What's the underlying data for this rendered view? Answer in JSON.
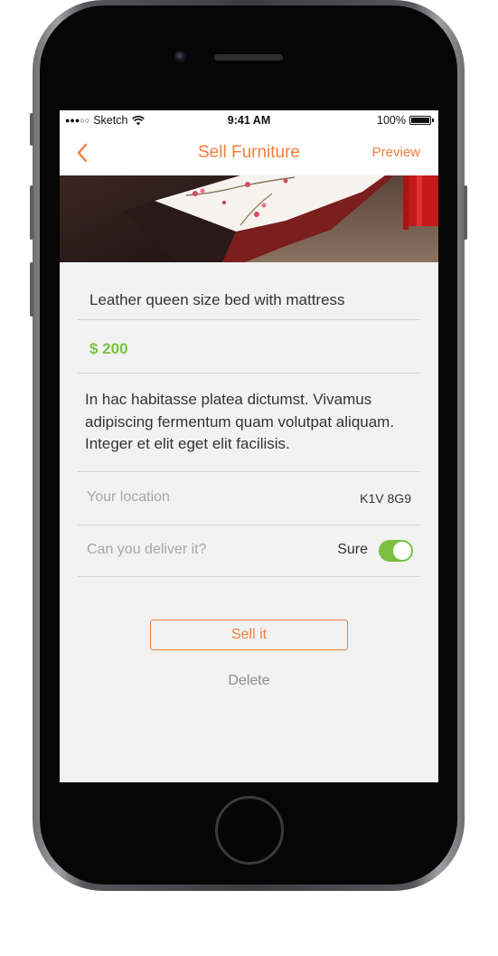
{
  "status_bar": {
    "signal": "●●●○○",
    "carrier": "Sketch",
    "wifi_icon": "wifi-icon",
    "time": "9:41 AM",
    "battery": "100%"
  },
  "nav": {
    "back_icon": "chevron-left-icon",
    "title": "Sell Furniture",
    "preview_label": "Preview"
  },
  "listing": {
    "title": "Leather queen size bed with mattress",
    "price": "$ 200",
    "description": "In hac habitasse platea dictumst. Vivamus adipiscing fermentum quam volutpat aliquam. Integer et elit eget elit facilisis.",
    "location_label": "Your location",
    "location_value": "K1V 8G9",
    "deliver_label": "Can you deliver it?",
    "deliver_value": "Sure",
    "deliver_enabled": true
  },
  "actions": {
    "sell_label": "Sell it",
    "delete_label": "Delete"
  },
  "colors": {
    "accent": "#f27d3d",
    "price": "#7ac142",
    "toggle_on": "#7ac142",
    "background": "#f2f2f2"
  }
}
